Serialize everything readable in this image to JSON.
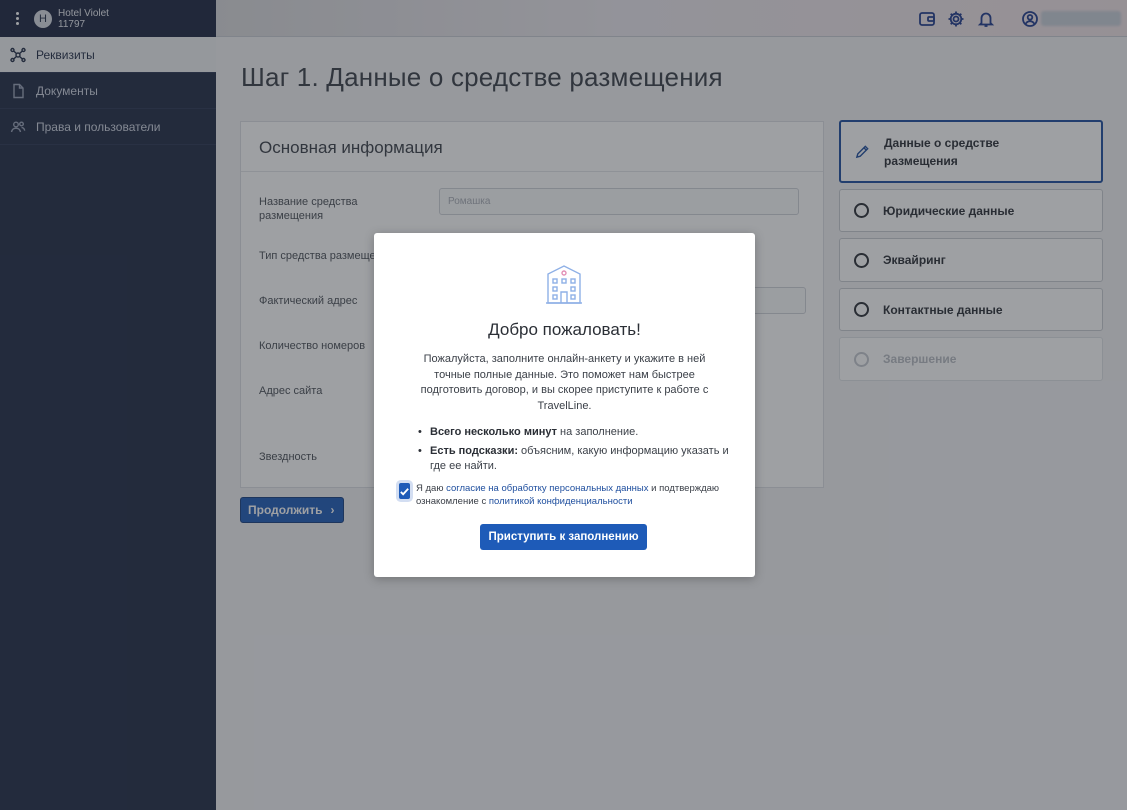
{
  "hotel": {
    "avatar_letter": "H",
    "name": "Hotel Violet",
    "id": "11797"
  },
  "sidebar": {
    "items": [
      {
        "label": "Реквизиты",
        "icon": "network-icon",
        "active": true
      },
      {
        "label": "Документы",
        "icon": "document-icon",
        "active": false
      },
      {
        "label": "Права и пользователи",
        "icon": "users-icon",
        "active": false
      }
    ]
  },
  "topbar": {
    "icons": [
      "wallet-icon",
      "gear-icon",
      "bell-icon",
      "user-circle-icon"
    ]
  },
  "main": {
    "title": "Шаг 1. Данные о средстве размещения",
    "card": {
      "title": "Основная информация",
      "fields": [
        {
          "label": "Название средства размещения",
          "placeholder": "Ромашка"
        },
        {
          "label": "Тип средства размещения"
        },
        {
          "label": "Фактический адрес"
        },
        {
          "label": "Количество номеров"
        },
        {
          "label": "Адрес сайта"
        },
        {
          "label": "Звездность"
        }
      ]
    },
    "continue_label": "Продолжить"
  },
  "steps": [
    {
      "label": "Данные о средстве размещения",
      "state": "current"
    },
    {
      "label": "Юридические данные",
      "state": "pending"
    },
    {
      "label": "Эквайринг",
      "state": "pending"
    },
    {
      "label": "Контактные данные",
      "state": "pending"
    },
    {
      "label": "Завершение",
      "state": "disabled"
    }
  ],
  "modal": {
    "title": "Добро пожаловать!",
    "text": "Пожалуйста, заполните онлайн-анкету и укажите в ней точные полные данные. Это поможет нам быстрее подготовить договор, и вы скорее приступите к работе с TravelLine.",
    "bullet1_bold": "Всего несколько минут",
    "bullet1_rest": " на заполнение.",
    "bullet2_bold": "Есть подсказки:",
    "bullet2_rest": " объясним, какую информацию указать и где ее найти.",
    "consent_prefix": "Я даю ",
    "consent_link1": "согласие на обработку персональных данных",
    "consent_mid": " и подтверждаю ознакомление с ",
    "consent_link2": "политикой конфиденциальности",
    "consent_checked": true,
    "start_label": "Приступить к заполнению"
  },
  "colors": {
    "sidebar_bg": "#1f2a44",
    "primary": "#1e5bb8",
    "link": "#1e4e9e"
  }
}
